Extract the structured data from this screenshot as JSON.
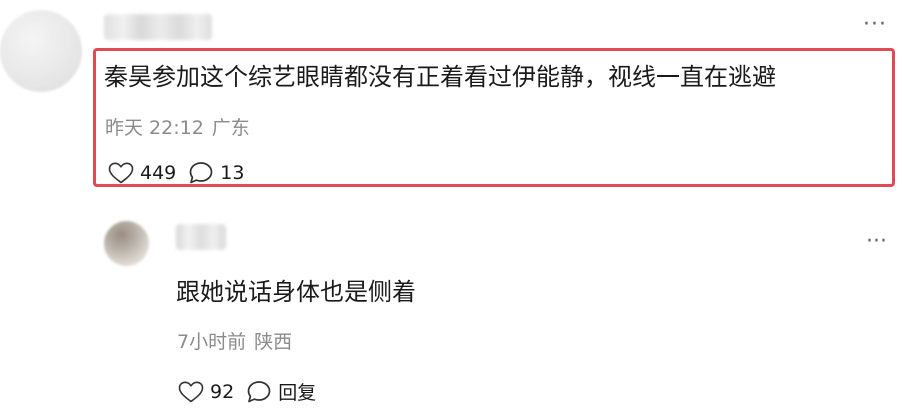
{
  "top_comment": {
    "text": "秦昊参加这个综艺眼睛都没有正着看过伊能静，视线一直在逃避",
    "date": "昨天 22:12",
    "location": "广东",
    "likes": "449",
    "replies": "13",
    "more_icon": "more-dots-icon",
    "like_icon": "heart-icon",
    "reply_icon": "comment-icon",
    "highlight_color": "#e04a55"
  },
  "reply_comment": {
    "text": "跟她说话身体也是侧着",
    "date": "7小时前",
    "location": "陕西",
    "likes": "92",
    "reply_label": "回复",
    "more_icon": "more-dots-icon",
    "like_icon": "heart-icon",
    "reply_icon": "comment-icon"
  },
  "symbols": {
    "more": "···"
  }
}
